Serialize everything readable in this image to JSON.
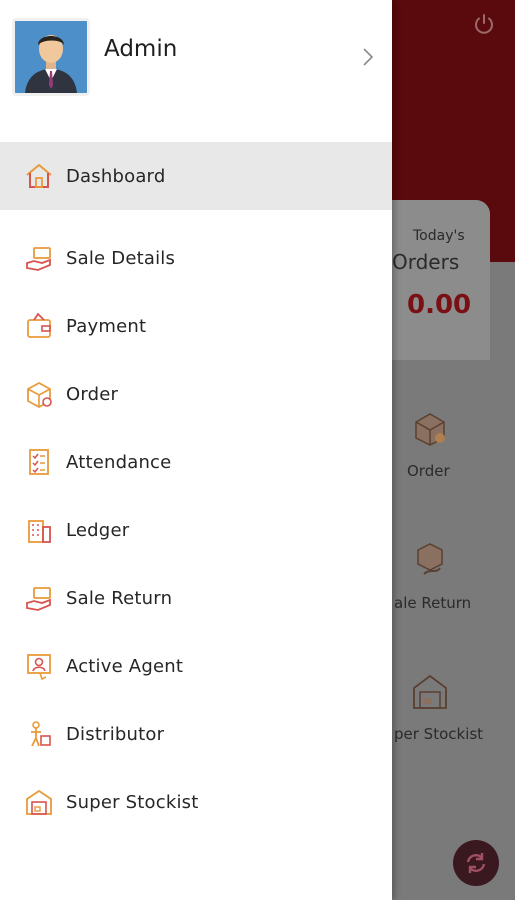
{
  "background": {
    "todays_label": "Today's",
    "orders_title": "Orders",
    "orders_value": "0.00",
    "tiles": [
      {
        "label": "Order",
        "icon": "order-box-icon"
      },
      {
        "label": "ale Return",
        "icon": "sale-return-icon"
      },
      {
        "label": "per Stockist",
        "icon": "warehouse-icon"
      }
    ],
    "power_icon": "power-icon",
    "refresh_icon": "refresh-icon"
  },
  "drawer": {
    "user_name": "Admin",
    "items": [
      {
        "label": "Dashboard",
        "icon": "home-icon",
        "active": true
      },
      {
        "label": "Sale Details",
        "icon": "hand-money-icon"
      },
      {
        "label": "Payment",
        "icon": "wallet-icon"
      },
      {
        "label": "Order",
        "icon": "order-box-icon"
      },
      {
        "label": "Attendance",
        "icon": "checklist-icon"
      },
      {
        "label": "Ledger",
        "icon": "building-icon"
      },
      {
        "label": "Sale Return",
        "icon": "hand-money-icon"
      },
      {
        "label": "Active Agent",
        "icon": "agent-icon"
      },
      {
        "label": "Distributor",
        "icon": "delivery-person-icon"
      },
      {
        "label": "Super Stockist",
        "icon": "warehouse-icon"
      }
    ]
  },
  "colors": {
    "header_red": "#7a0f12",
    "accent_orange": "#e99a3a",
    "accent_red": "#c0392b",
    "active_bg": "#e8e8e8"
  }
}
